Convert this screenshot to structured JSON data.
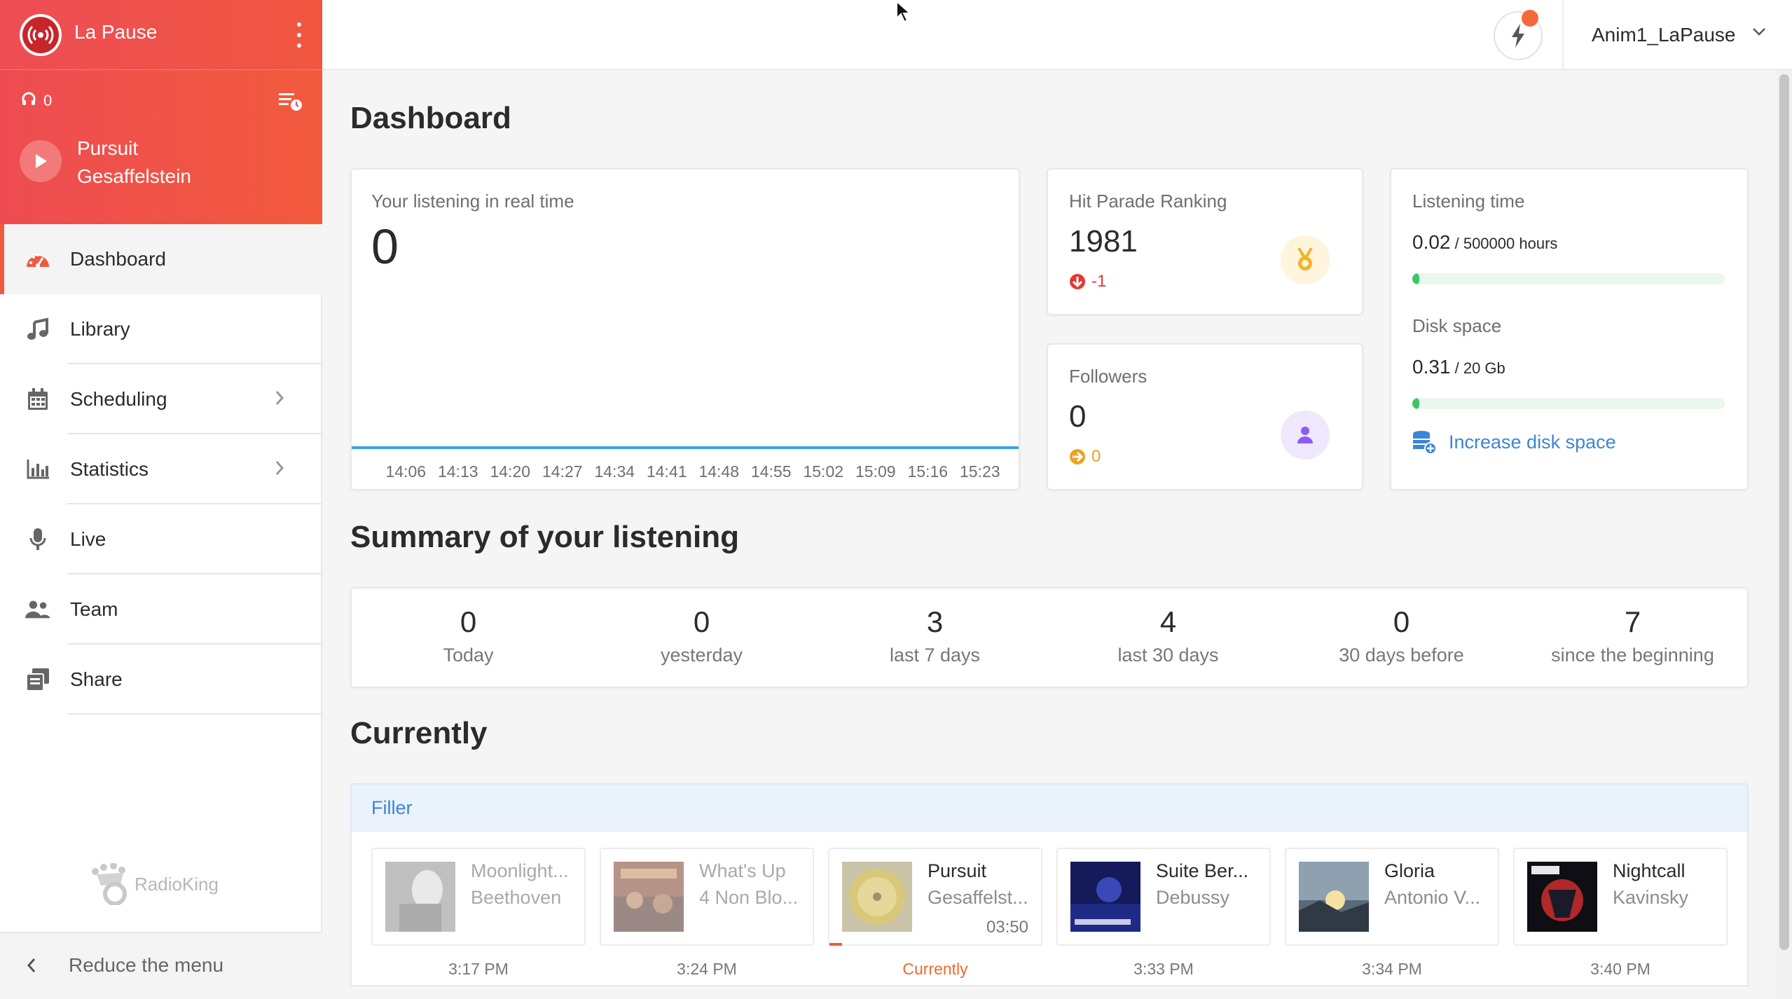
{
  "station": {
    "name": "La Pause"
  },
  "player": {
    "listeners": "0",
    "track_title": "Pursuit",
    "track_artist": "Gesaffelstein"
  },
  "nav": {
    "items": [
      {
        "label": "Dashboard",
        "icon": "gauge-icon"
      },
      {
        "label": "Library",
        "icon": "music-note-icon"
      },
      {
        "label": "Scheduling",
        "icon": "calendar-icon"
      },
      {
        "label": "Statistics",
        "icon": "bar-chart-icon"
      },
      {
        "label": "Live",
        "icon": "microphone-icon"
      },
      {
        "label": "Team",
        "icon": "users-icon"
      },
      {
        "label": "Share",
        "icon": "share-icon"
      }
    ],
    "reduce_label": "Reduce the menu",
    "brand": "RadioKing"
  },
  "topbar": {
    "username": "Anim1_LaPause"
  },
  "dashboard": {
    "title": "Dashboard",
    "realtime": {
      "label": "Your listening in real time",
      "value": "0",
      "times": [
        "14:06",
        "14:13",
        "14:20",
        "14:27",
        "14:34",
        "14:41",
        "14:48",
        "14:55",
        "15:02",
        "15:09",
        "15:16",
        "15:23"
      ]
    },
    "hit_parade": {
      "label": "Hit Parade Ranking",
      "value": "1981",
      "change": "-1"
    },
    "followers": {
      "label": "Followers",
      "value": "0",
      "change": "0"
    },
    "listening_time": {
      "label": "Listening time",
      "value": "0.02",
      "total": " / 500000 hours",
      "fraction": 4e-08
    },
    "disk_space": {
      "label": "Disk space",
      "value": "0.31",
      "total": " / 20 Gb",
      "fraction": 0.0155
    },
    "increase_disk": "Increase disk space"
  },
  "summary": {
    "title": "Summary of your listening",
    "items": [
      {
        "value": "0",
        "label": "Today"
      },
      {
        "value": "0",
        "label": "yesterday"
      },
      {
        "value": "3",
        "label": "last 7 days"
      },
      {
        "value": "4",
        "label": "last 30 days"
      },
      {
        "value": "0",
        "label": "30 days before"
      },
      {
        "value": "7",
        "label": "since the beginning"
      }
    ]
  },
  "currently": {
    "title": "Currently",
    "playlist": "Filler",
    "tracks": [
      {
        "title": "Moonlight...",
        "artist": "Beethoven",
        "time": "3:17 PM"
      },
      {
        "title": "What's Up",
        "artist": "4 Non Blo...",
        "time": "3:24 PM"
      },
      {
        "title": "Pursuit",
        "artist": "Gesaffelst...",
        "duration": "03:50",
        "time": "Currently"
      },
      {
        "title": "Suite Ber...",
        "artist": "Debussy",
        "time": "3:33 PM"
      },
      {
        "title": "Gloria",
        "artist": "Antonio V...",
        "time": "3:34 PM"
      },
      {
        "title": "Nightcall",
        "artist": "Kavinsky",
        "time": "3:40 PM"
      }
    ]
  },
  "colors": {
    "brand_gradient_start": "#ee4d55",
    "brand_gradient_end": "#f0563f",
    "accent_blue": "#3b86d6",
    "progress_green": "#39c767",
    "down_red": "#e53935",
    "medal_gold": "#f0b429",
    "follower_purple": "#8b5cf6"
  }
}
